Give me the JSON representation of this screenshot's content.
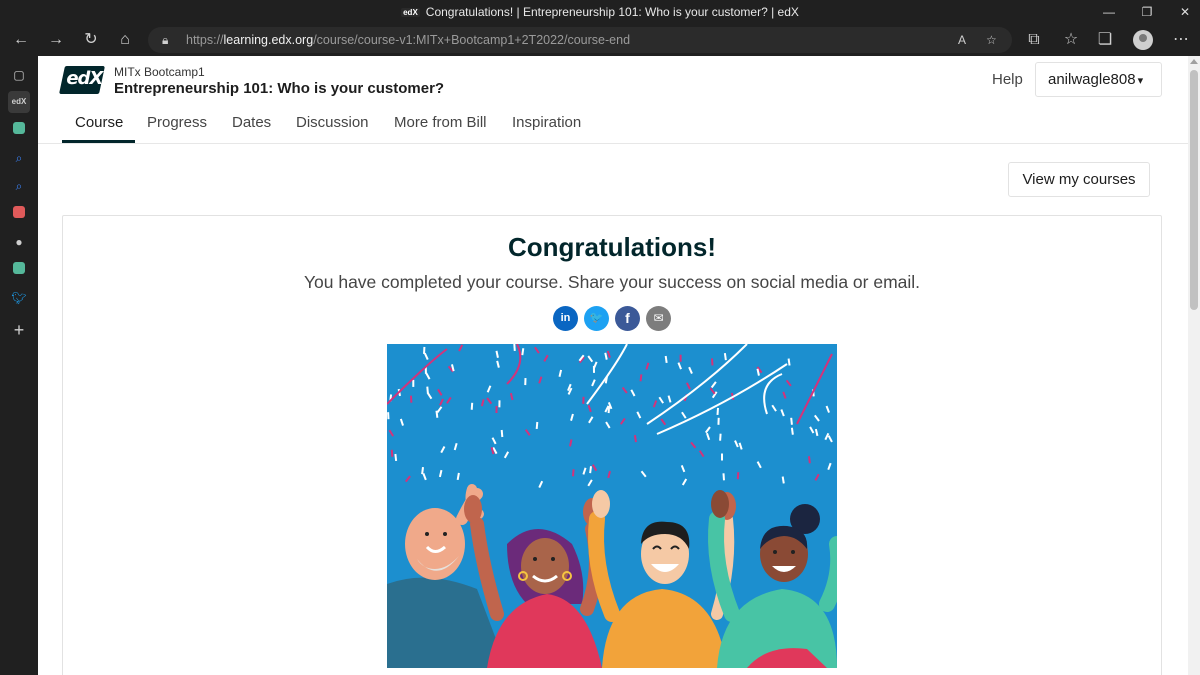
{
  "window": {
    "tab_title": "Congratulations! | Entrepreneurship 101: Who is your customer? | edX",
    "favicon_text": "edX",
    "minimize": "—",
    "restore": "❐",
    "close": "✕"
  },
  "toolbar": {
    "url_prefix": "https://",
    "url_host": "learning.edx.org",
    "url_path": "/course/course-v1:MITx+Bootcamp1+2T2022/course-end"
  },
  "header": {
    "logo_text": "edX",
    "org": "MITx Bootcamp1",
    "course_title": "Entrepreneurship 101: Who is your customer?",
    "help": "Help",
    "username": "anilwagle808"
  },
  "tabs": [
    {
      "label": "Course"
    },
    {
      "label": "Progress"
    },
    {
      "label": "Dates"
    },
    {
      "label": "Discussion"
    },
    {
      "label": "More from Bill"
    },
    {
      "label": "Inspiration"
    }
  ],
  "view_courses": "View my courses",
  "celebration": {
    "heading": "Congratulations!",
    "message": "You have completed your course. Share your success on social media or email.",
    "share": [
      {
        "name": "linkedin",
        "glyph": "in",
        "color": "#0a66c2"
      },
      {
        "name": "twitter",
        "glyph": "🐦",
        "color": "#1da1f2"
      },
      {
        "name": "facebook",
        "glyph": "f",
        "color": "#3b5998"
      },
      {
        "name": "email",
        "glyph": "✉",
        "color": "#7d7d7d"
      }
    ]
  },
  "colors": {
    "brand_dark": "#02262b",
    "hero_sky": "#1c8fcf",
    "confetti_pink": "#d3337b",
    "confetti_white": "#ffffff"
  }
}
